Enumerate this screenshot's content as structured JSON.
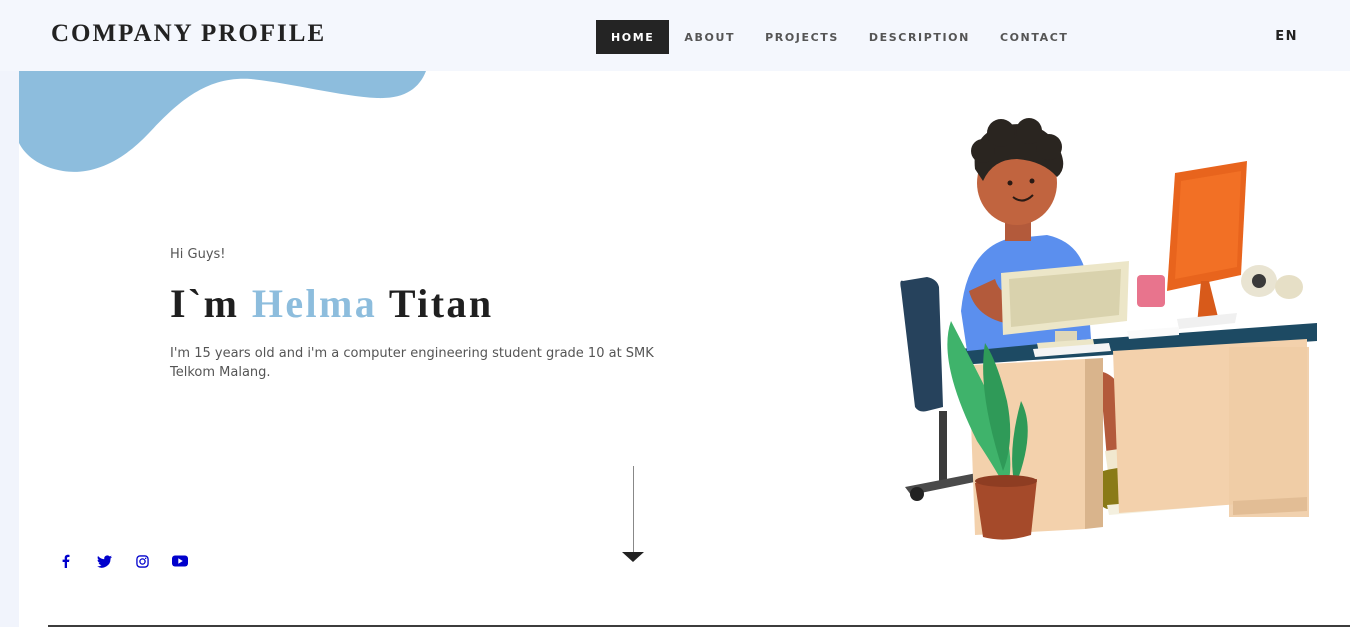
{
  "header": {
    "brand": "COMPANY PROFILE",
    "nav": [
      "HOME",
      "ABOUT",
      "PROJECTS",
      "DESCRIPTION",
      "CONTACT"
    ],
    "active_nav": "HOME",
    "language": "EN"
  },
  "hero": {
    "greeting": "Hi Guys!",
    "title_prefix": "I`m",
    "title_highlight": "Helma",
    "title_suffix": "Titan",
    "description": "I'm 15 years old and i'm a computer engineering student grade 10 at SMK Telkom Malang."
  },
  "social": {
    "icons": [
      "facebook-icon",
      "twitter-icon",
      "instagram-icon",
      "youtube-icon"
    ],
    "color": "#0000cc"
  },
  "colors": {
    "accent": "#8dbddd",
    "nav_active_bg": "#242424",
    "header_bg": "#f4f7fd"
  }
}
